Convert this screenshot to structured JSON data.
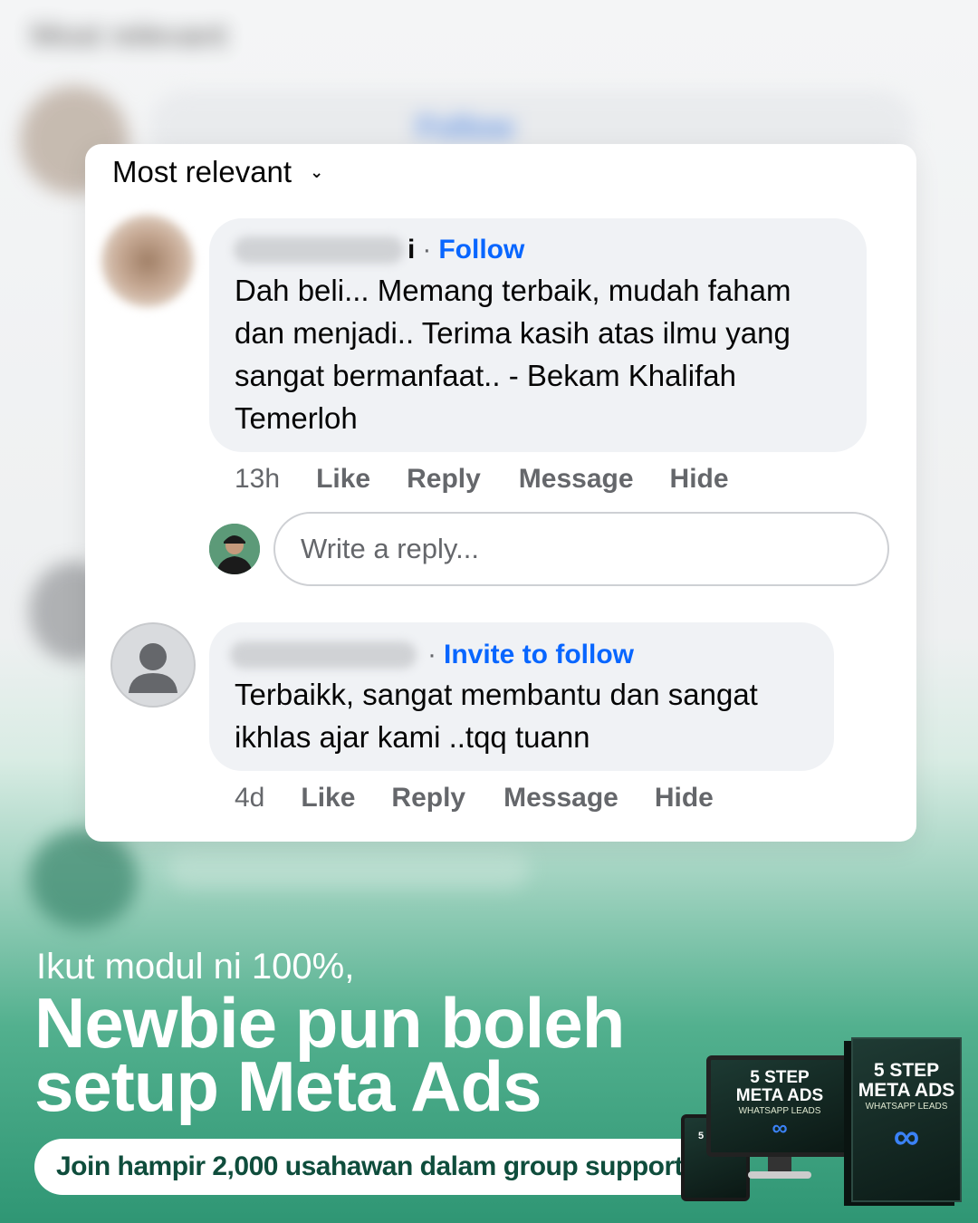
{
  "background": {
    "sort_label": "Most relevant",
    "follow_label": "Follow"
  },
  "card": {
    "sort_label": "Most relevant",
    "sort_icon": "chevron-down-icon"
  },
  "comments": [
    {
      "name_tail": "i",
      "follow_label": "Follow",
      "lines": [
        "Dah beli... Memang terbaik, mudah faham",
        "dan menjadi.. Terima kasih atas ilmu yang",
        "sangat bermanfaat.. - Bekam Khalifah",
        "Temerloh"
      ],
      "time": "13h",
      "actions": [
        "Like",
        "Reply",
        "Message",
        "Hide"
      ]
    },
    {
      "name_tail": "",
      "follow_label": "Invite to follow",
      "lines": [
        "Terbaikk, sangat membantu dan sangat",
        "ikhlas ajar kami ..tqq tuann"
      ],
      "time": "4d",
      "actions": [
        "Like",
        "Reply",
        "Message",
        "Hide"
      ]
    }
  ],
  "reply": {
    "placeholder": "Write a reply..."
  },
  "promo": {
    "subtitle": "Ikut modul ni 100%,",
    "title_line1": "Newbie pun boleh",
    "title_line2": "setup Meta Ads",
    "cta_label": "Join hampir 2,000 usahawan dalam group support",
    "cta_icon": "arrow-right-icon"
  },
  "product": {
    "line1": "5 STEP",
    "line2": "META ADS",
    "line3": "WHATSAPP LEADS",
    "logo": "∞"
  },
  "colors": {
    "link": "#0866ff",
    "promo_green": "#2f9674",
    "cta_text": "#0f4d3c"
  }
}
